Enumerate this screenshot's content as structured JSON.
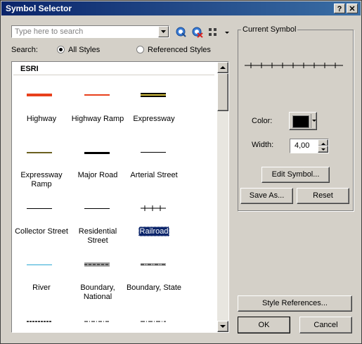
{
  "window": {
    "title": "Symbol Selector",
    "help_label": "?",
    "close_label": "✕"
  },
  "search": {
    "placeholder": "Type here to search",
    "scope_label": "Search:",
    "option_all": "All Styles",
    "option_referenced": "Referenced Styles",
    "selected": "All Styles"
  },
  "toolbar": {
    "icons": [
      "search-icon",
      "clear-search-icon",
      "view-options-icon"
    ]
  },
  "gallery": {
    "group_header": "ESRI",
    "rows": [
      [
        "Highway",
        "Highway Ramp",
        "Expressway"
      ],
      [
        "Expressway Ramp",
        "Major Road",
        "Arterial Street"
      ],
      [
        "Collector Street",
        "Residential Street",
        "Railroad"
      ],
      [
        "River",
        "Boundary, National",
        "Boundary, State"
      ]
    ],
    "selected": "Railroad",
    "colors": {
      "highway": "#e8401c",
      "ramp": "#e8401c",
      "expressway": "#b4a020",
      "river": "#2aa8d4",
      "line": "#000000"
    }
  },
  "current_symbol": {
    "group_label": "Current Symbol",
    "color_label": "Color:",
    "color_value": "#000000",
    "width_label": "Width:",
    "width_value": "4,00",
    "edit_label": "Edit Symbol...",
    "save_label": "Save As...",
    "reset_label": "Reset"
  },
  "footer": {
    "style_refs_label": "Style References...",
    "ok_label": "OK",
    "cancel_label": "Cancel"
  }
}
